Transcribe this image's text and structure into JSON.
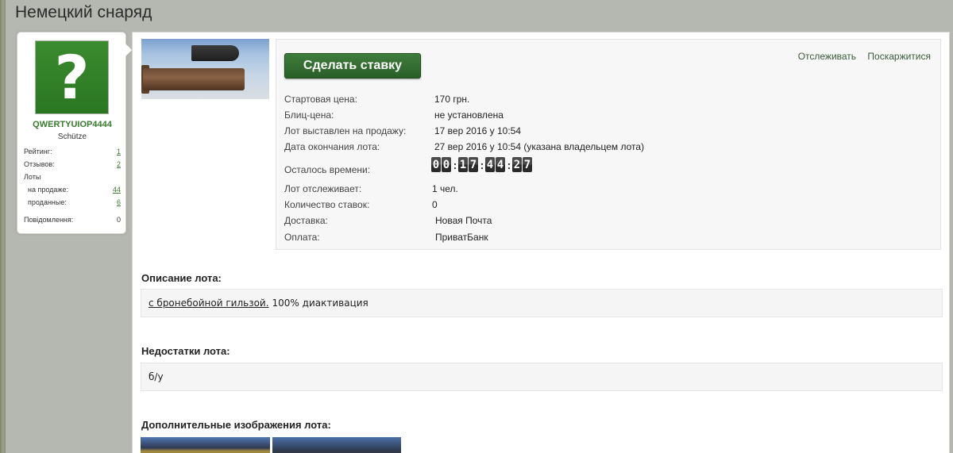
{
  "page": {
    "title": "Немецкий снаряд"
  },
  "user": {
    "avatar_glyph": "?",
    "username": "QWERTYUIOP4444",
    "title": "Schütze",
    "stats": [
      {
        "label": "Рейтинг:",
        "value": "1"
      },
      {
        "label": "Отзывов:",
        "value": "2"
      },
      {
        "label": "Лоты",
        "value": ""
      },
      {
        "label": "на продаже:",
        "value": "44"
      },
      {
        "label": "проданные:",
        "value": "6"
      },
      {
        "label": "Повідомлення:",
        "value": "0"
      }
    ]
  },
  "lot": {
    "bid_button": "Сделать ставку",
    "links": {
      "watch": "Отслеживать",
      "complain": "Поскаржитися"
    },
    "fields": [
      {
        "label": "Стартовая цена:",
        "value": "170 грн."
      },
      {
        "label": "Блиц-цена:",
        "value": "не установлена"
      },
      {
        "label": "Лот выставлен на продажу:",
        "value": "17 вер 2016 у 10:54"
      },
      {
        "label": "Дата окончания лота:",
        "value": "27 вер 2016 у 10:54 (указана владельцем лота)"
      }
    ],
    "time_left_label": "Осталось времени:",
    "timer": {
      "d1": "0",
      "d2": "0",
      "h1": "1",
      "h2": "7",
      "m1": "4",
      "m2": "4",
      "s1": "2",
      "s2": "7"
    },
    "fields2": [
      {
        "label": "Лот отслеживает:",
        "value": "1 чел."
      },
      {
        "label": "Количество ставок:",
        "value": "0"
      },
      {
        "label": "Доставка:",
        "value": "Новая Почта"
      },
      {
        "label": "Оплата:",
        "value": "ПриватБанк"
      }
    ]
  },
  "description": {
    "title": "Описание лота:",
    "link_text": "с бронебойной гильзой.",
    "text": "100% диактивация"
  },
  "defects": {
    "title": "Недостатки лота:",
    "text": "б/у"
  },
  "more_images": {
    "title": "Дополнительные изображения лота:"
  },
  "colors": {
    "accent_green": "#3a7a2f",
    "button_green": "#2f6a2c",
    "background": "#b4b8b1"
  }
}
